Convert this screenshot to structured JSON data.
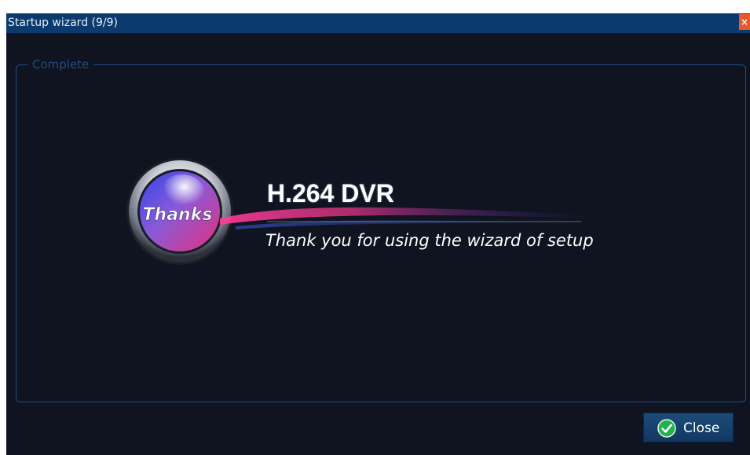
{
  "window": {
    "title": "Startup wizard (9/9)",
    "close_glyph": "×"
  },
  "group": {
    "legend": "Complete"
  },
  "badge": {
    "text": "Thanks",
    "icon": "thanks-badge"
  },
  "main": {
    "product_title": "H.264 DVR",
    "message": "Thank you for using the wizard of setup"
  },
  "footer": {
    "close_label": "Close",
    "close_icon": "check-circle-icon"
  },
  "colors": {
    "titlebar": "#0a3a6e",
    "background": "#0f1420",
    "group_border": "#1e4f86",
    "close_accent": "#e8572a",
    "button": "#1c4b7a",
    "check": "#22b14c"
  }
}
